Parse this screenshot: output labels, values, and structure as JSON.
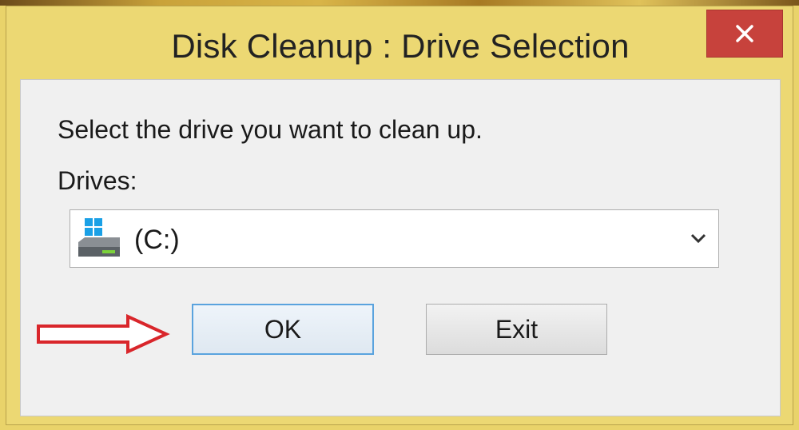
{
  "window": {
    "title": "Disk Cleanup : Drive Selection",
    "close_label": "×"
  },
  "content": {
    "instruction": "Select the drive you want to clean up.",
    "drives_label": "Drives:",
    "selected_drive": "(C:)"
  },
  "buttons": {
    "ok_label": "OK",
    "exit_label": "Exit"
  },
  "icons": {
    "drive": "windows-drive-icon",
    "dropdown": "chevron-down-icon",
    "annotation": "red-arrow-icon"
  },
  "colors": {
    "frame": "#ecd873",
    "close": "#c7423c",
    "focus": "#5aa3de",
    "arrow": "#d9262b"
  }
}
